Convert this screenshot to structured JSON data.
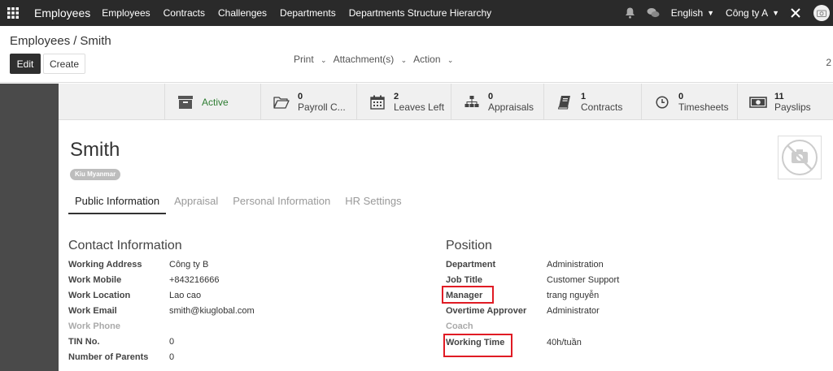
{
  "navbar": {
    "brand": "Employees",
    "menu": [
      "Employees",
      "Contracts",
      "Challenges",
      "Departments",
      "Departments Structure Hierarchy"
    ],
    "language": "English",
    "company": "Công ty A"
  },
  "control": {
    "breadcrumb_parent": "Employees",
    "breadcrumb_sep": "/",
    "breadcrumb_current": "Smith",
    "edit_label": "Edit",
    "create_label": "Create",
    "print_label": "Print",
    "attachment_label": "Attachment(s)",
    "action_label": "Action",
    "pager": "2"
  },
  "stat_buttons": {
    "active": "Active",
    "payroll": {
      "num": "0",
      "label": "Payroll C..."
    },
    "leaves": {
      "num": "2",
      "label": "Leaves Left"
    },
    "appraisals": {
      "num": "0",
      "label": "Appraisals"
    },
    "contracts": {
      "num": "1",
      "label": "Contracts"
    },
    "timesheets": {
      "num": "0",
      "label": "Timesheets"
    },
    "payslips": {
      "num": "11",
      "label": "Payslips"
    }
  },
  "employee": {
    "name": "Smith",
    "tag": "Kiu Myanmar"
  },
  "tabs": [
    "Public Information",
    "Appraisal",
    "Personal Information",
    "HR Settings"
  ],
  "contact": {
    "title": "Contact Information",
    "fields": [
      {
        "label": "Working Address",
        "value": "Công ty B"
      },
      {
        "label": "Work Mobile",
        "value": "+843216666"
      },
      {
        "label": "Work Location",
        "value": "Lao cao"
      },
      {
        "label": "Work Email",
        "value": "smith@kiuglobal.com"
      },
      {
        "label": "Work Phone",
        "value": ""
      },
      {
        "label": "TIN No.",
        "value": "0"
      },
      {
        "label": "Number of Parents",
        "value": "0"
      }
    ]
  },
  "position": {
    "title": "Position",
    "fields": [
      {
        "label": "Department",
        "value": "Administration"
      },
      {
        "label": "Job Title",
        "value": "Customer Support"
      },
      {
        "label": "Manager",
        "value": "trang nguyễn"
      },
      {
        "label": "Overtime Approver",
        "value": "Administrator"
      },
      {
        "label": "Coach",
        "value": ""
      },
      {
        "label": "Working Time",
        "value": "40h/tuần"
      }
    ]
  },
  "colors": {
    "navbar": "#2a2a2a",
    "active_status": "#2e7d32",
    "highlight": "#e01b24"
  }
}
